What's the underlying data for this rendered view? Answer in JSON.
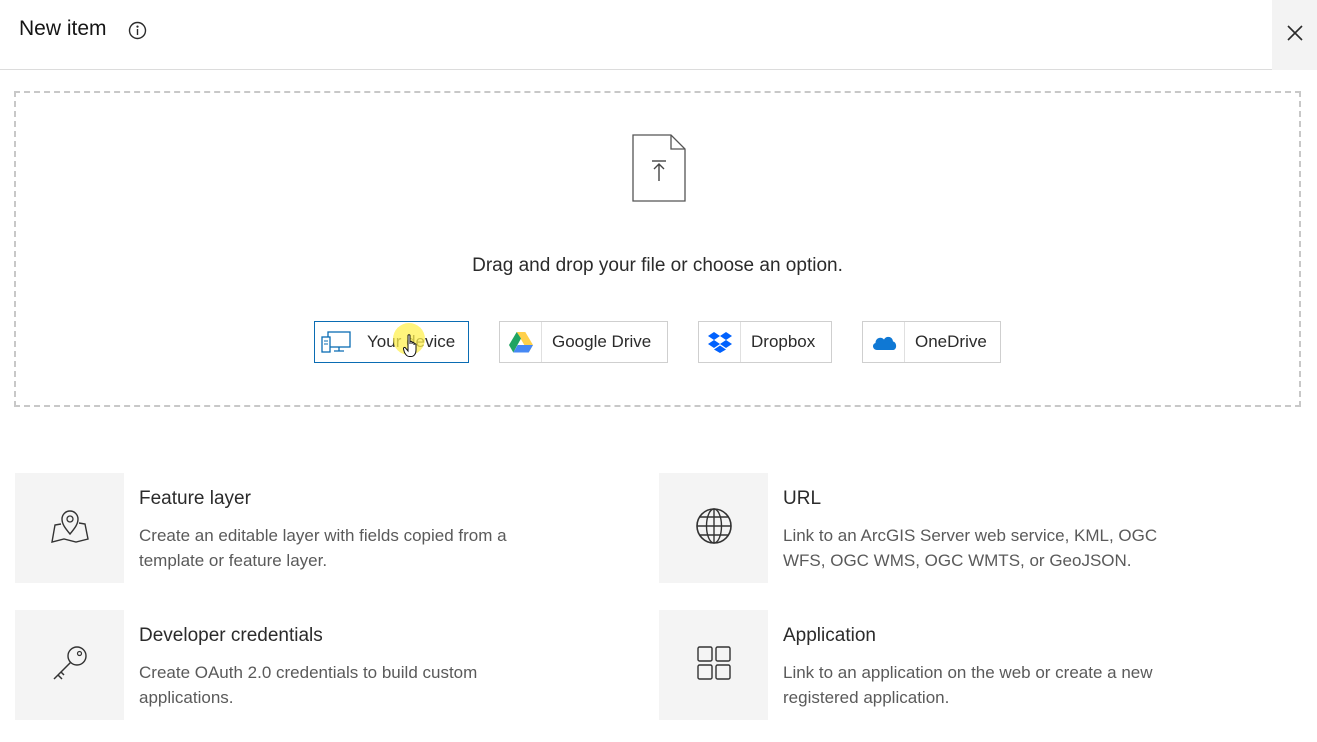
{
  "header": {
    "title": "New item",
    "info_icon": "info-circle-icon",
    "close_icon": "close-icon"
  },
  "dropzone": {
    "icon": "file-upload-icon",
    "prompt": "Drag and drop your file or choose an option.",
    "options": [
      {
        "label": "Your device",
        "icon": "desktop-device-icon",
        "active": true
      },
      {
        "label": "Google Drive",
        "icon": "google-drive-icon",
        "active": false
      },
      {
        "label": "Dropbox",
        "icon": "dropbox-icon",
        "active": false
      },
      {
        "label": "OneDrive",
        "icon": "onedrive-icon",
        "active": false
      }
    ]
  },
  "cards": [
    {
      "title": "Feature layer",
      "description": "Create an editable layer with fields copied from a template or feature layer.",
      "icon": "map-pin-icon"
    },
    {
      "title": "URL",
      "description": "Link to an ArcGIS Server web service, KML, OGC WFS, OGC WMS, OGC WMTS, or GeoJSON.",
      "icon": "globe-icon"
    },
    {
      "title": "Developer credentials",
      "description": "Create OAuth 2.0 credentials to build custom applications.",
      "icon": "key-icon"
    },
    {
      "title": "Application",
      "description": "Link to an application on the web or create a new registered application.",
      "icon": "grid-apps-icon"
    }
  ],
  "colors": {
    "accent": "#0a6cb3",
    "google_green": "#1fa463",
    "google_yellow": "#ffd04b",
    "google_blue": "#4688f4",
    "dropbox_blue": "#0061fe",
    "onedrive_blue": "#0f78d4",
    "cursor_highlight": "#fff050"
  }
}
